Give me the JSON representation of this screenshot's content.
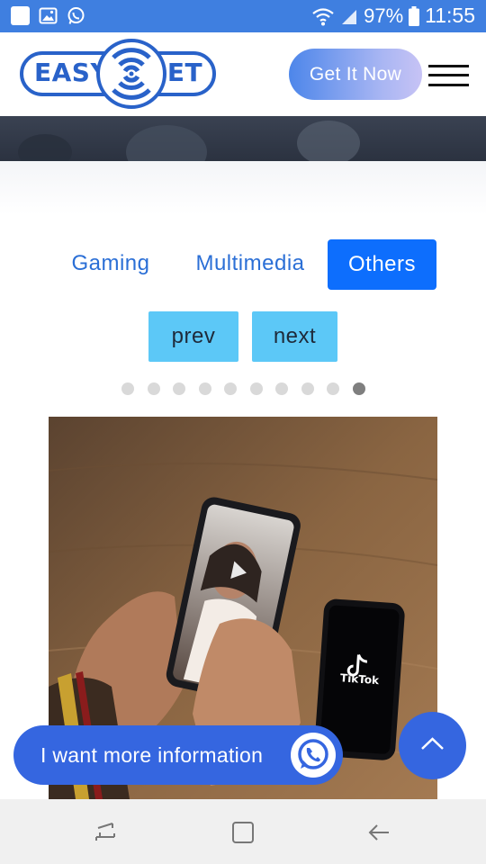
{
  "status_bar": {
    "battery": "97%",
    "time": "11:55",
    "icons": [
      "notification-square-icon",
      "image-icon",
      "whatsapp-icon",
      "wifi-icon",
      "signal-icon",
      "battery-icon"
    ]
  },
  "header": {
    "logo_left": "EASY",
    "logo_right": "NET",
    "cta_label": "Get It Now",
    "menu_icon": "hamburger-icon"
  },
  "tabs": [
    {
      "label": "Gaming",
      "active": false
    },
    {
      "label": "Multimedia",
      "active": false
    },
    {
      "label": "Others",
      "active": true
    }
  ],
  "pager": {
    "prev_label": "prev",
    "next_label": "next",
    "dot_count": 10,
    "active_index": 9
  },
  "photo": {
    "caption_text": "TikTok"
  },
  "floating": {
    "whatsapp_label": "I want more information",
    "scroll_top_icon": "chevron-up-icon"
  },
  "system_nav": {
    "icons": [
      "recent-apps-icon",
      "home-icon",
      "back-icon"
    ]
  },
  "colors": {
    "brand_blue": "#2962c9",
    "status_bar": "#3f7fe0",
    "active_tab": "#0d6efd",
    "nav_button": "#5cc8f7",
    "floating_button": "#3566e0"
  }
}
